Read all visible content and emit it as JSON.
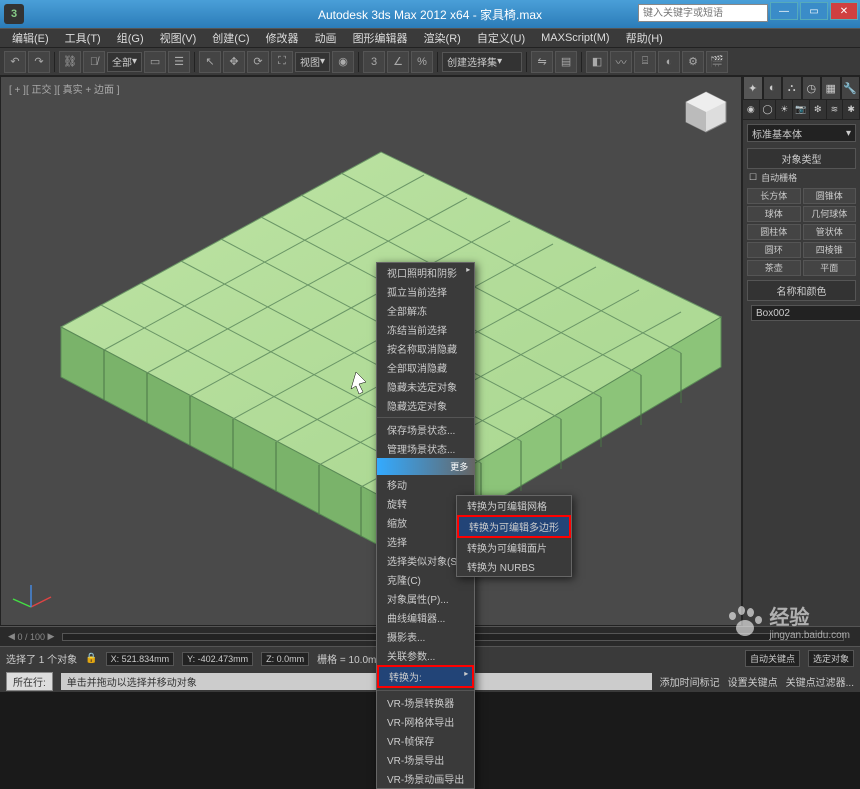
{
  "title": "Autodesk 3ds Max  2012 x64  -  家具椅.max",
  "search_placeholder": "键入关键字或短语",
  "menu": [
    "编辑(E)",
    "工具(T)",
    "组(G)",
    "视图(V)",
    "创建(C)",
    "修改器",
    "动画",
    "图形编辑器",
    "渲染(R)",
    "自定义(U)",
    "MAXScript(M)",
    "帮助(H)"
  ],
  "toolbar_dropdowns": {
    "all": "全部",
    "view": "视图",
    "select_set": "创建选择集"
  },
  "viewport_label": "[ + ][ 正交 ][ 真实 + 边面 ]",
  "command_panel": {
    "category": "标准基本体",
    "section_objtype": "对象类型",
    "autogrid": "自动栅格",
    "primitives": [
      [
        "长方体",
        "圆锥体"
      ],
      [
        "球体",
        "几何球体"
      ],
      [
        "圆柱体",
        "管状体"
      ],
      [
        "圆环",
        "四棱锥"
      ],
      [
        "茶壶",
        "平面"
      ]
    ],
    "section_namecolor": "名称和颜色",
    "object_name": "Box002"
  },
  "context_menu": {
    "items_top": [
      "视口照明和阴影",
      "孤立当前选择",
      "全部解冻",
      "冻结当前选择",
      "按名称取消隐藏",
      "全部取消隐藏",
      "隐藏未选定对象",
      "隐藏选定对象"
    ],
    "items_mid": [
      "保存场景状态...",
      "管理场景状态..."
    ],
    "head2_suffix": "更多",
    "items_trans": [
      "移动",
      "旋转",
      "缩放",
      "选择",
      "选择类似对象(S)",
      "克隆(C)",
      "对象属性(P)...",
      "曲线编辑器...",
      "摄影表...",
      "关联参数..."
    ],
    "convert": "转换为:",
    "vray_items": [
      "VR-场景转换器",
      "VR-网格体导出",
      "VR-帧保存",
      "VR-场景导出",
      "VR-场景动画导出"
    ],
    "submenu": {
      "items": [
        "转换为可编辑网格",
        "转换为可编辑多边形",
        "转换为可编辑面片",
        "转换为 NURBS"
      ]
    }
  },
  "status": {
    "selection": "选择了 1 个对象",
    "x": "X: 521.834mm",
    "y": "Y: -402.473mm",
    "z": "Z: 0.0mm",
    "grid": "栅格 = 10.0mm",
    "autokey": "自动关键点",
    "selobj": "选定对象",
    "setkey": "设置关键点",
    "keyfilter": "关键点过滤器...",
    "prompt": "单击并拖动以选择并移动对象",
    "tab": "所在行:",
    "addtime": "添加时间标记"
  },
  "timeline": {
    "range": "0 / 100"
  },
  "watermark": {
    "text": "经验",
    "url": "jingyan.baidu.com"
  }
}
